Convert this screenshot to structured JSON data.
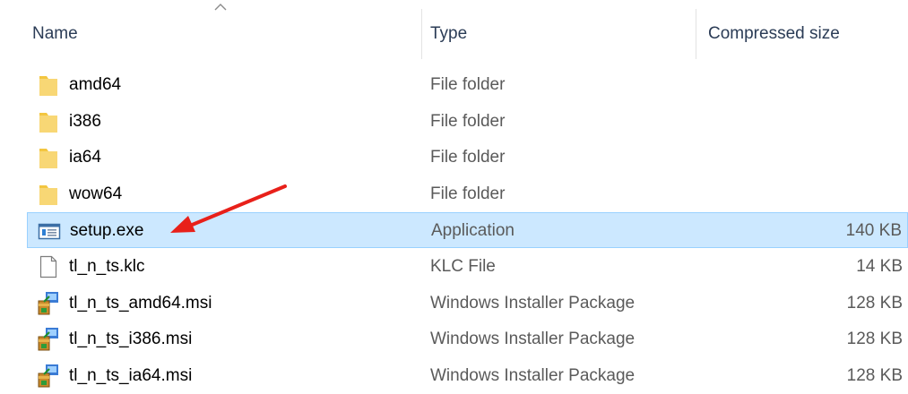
{
  "columns": {
    "name": "Name",
    "type": "Type",
    "size": "Compressed size"
  },
  "sort": {
    "column": "name",
    "icon": "chevron-up-icon"
  },
  "files": [
    {
      "name": "amd64",
      "type": "File folder",
      "size": "",
      "icon": "folder-icon",
      "selected": false
    },
    {
      "name": "i386",
      "type": "File folder",
      "size": "",
      "icon": "folder-icon",
      "selected": false
    },
    {
      "name": "ia64",
      "type": "File folder",
      "size": "",
      "icon": "folder-icon",
      "selected": false
    },
    {
      "name": "wow64",
      "type": "File folder",
      "size": "",
      "icon": "folder-icon",
      "selected": false
    },
    {
      "name": "setup.exe",
      "type": "Application",
      "size": "140 KB",
      "icon": "application-icon",
      "selected": true
    },
    {
      "name": "tl_n_ts.klc",
      "type": "KLC File",
      "size": "14 KB",
      "icon": "document-icon",
      "selected": false
    },
    {
      "name": "tl_n_ts_amd64.msi",
      "type": "Windows Installer Package",
      "size": "128 KB",
      "icon": "installer-package-icon",
      "selected": false
    },
    {
      "name": "tl_n_ts_i386.msi",
      "type": "Windows Installer Package",
      "size": "128 KB",
      "icon": "installer-package-icon",
      "selected": false
    },
    {
      "name": "tl_n_ts_ia64.msi",
      "type": "Windows Installer Package",
      "size": "128 KB",
      "icon": "installer-package-icon",
      "selected": false
    }
  ],
  "annotation": {
    "target": "setup.exe",
    "icon": "red-arrow-icon",
    "color": "#e8201a"
  },
  "colors": {
    "selection_bg": "#cce8ff",
    "selection_border": "#99d1ff",
    "folder": "#f8d775",
    "header_text": "#2b3c56"
  }
}
